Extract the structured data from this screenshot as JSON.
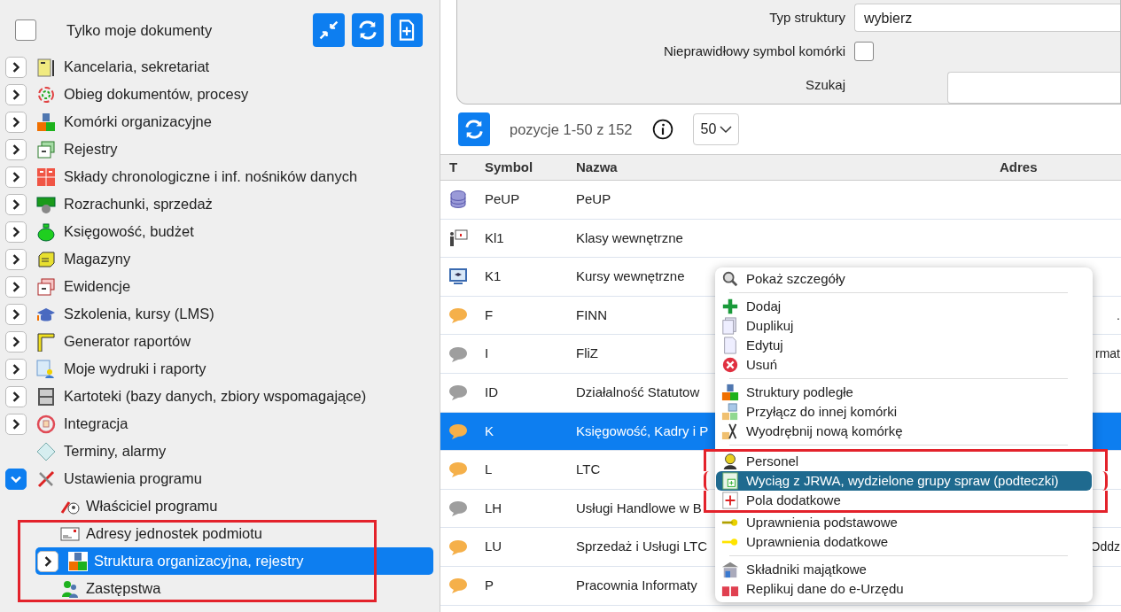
{
  "sidebar": {
    "only_mine": {
      "label": "Tylko moje dokumenty",
      "checked": false
    },
    "tree": [
      {
        "label": "Kancelaria, sekretariat",
        "expandable": true,
        "expanded": false,
        "selected": false
      },
      {
        "label": "Obieg dokumentów, procesy",
        "expandable": true,
        "expanded": false,
        "selected": false
      },
      {
        "label": "Komórki organizacyjne",
        "expandable": true,
        "expanded": false,
        "selected": false
      },
      {
        "label": "Rejestry",
        "expandable": true,
        "expanded": false,
        "selected": false
      },
      {
        "label": "Składy chronologiczne i inf. nośników danych",
        "expandable": true,
        "expanded": false,
        "selected": false
      },
      {
        "label": "Rozrachunki, sprzedaż",
        "expandable": true,
        "expanded": false,
        "selected": false
      },
      {
        "label": "Księgowość, budżet",
        "expandable": true,
        "expanded": false,
        "selected": false
      },
      {
        "label": "Magazyny",
        "expandable": true,
        "expanded": false,
        "selected": false
      },
      {
        "label": "Ewidencje",
        "expandable": true,
        "expanded": false,
        "selected": false
      },
      {
        "label": "Szkolenia, kursy (LMS)",
        "expandable": true,
        "expanded": false,
        "selected": false
      },
      {
        "label": "Generator raportów",
        "expandable": true,
        "expanded": false,
        "selected": false
      },
      {
        "label": "Moje wydruki i raporty",
        "expandable": true,
        "expanded": false,
        "selected": false
      },
      {
        "label": "Kartoteki (bazy danych, zbiory wspomagające)",
        "expandable": true,
        "expanded": false,
        "selected": false
      },
      {
        "label": "Integracja",
        "expandable": true,
        "expanded": false,
        "selected": false
      },
      {
        "label": "Terminy, alarmy",
        "expandable": false,
        "selected": false
      },
      {
        "label": "Ustawienia programu",
        "expandable": true,
        "expanded": true,
        "selected": false,
        "children": [
          {
            "label": "Właściciel programu",
            "expandable": false,
            "selected": false,
            "highlighted": false
          },
          {
            "label": "Adresy jednostek podmiotu",
            "expandable": false,
            "selected": false,
            "highlighted": true
          },
          {
            "label": "Struktura organizacyjna, rejestry",
            "expandable": true,
            "expanded": false,
            "selected": true,
            "highlighted": true
          },
          {
            "label": "Zastępstwa",
            "expandable": false,
            "selected": false,
            "highlighted": true
          }
        ]
      }
    ]
  },
  "filters": {
    "structure_type": {
      "label": "Typ struktury",
      "value": "wybierz"
    },
    "invalid_symbol": {
      "label": "Nieprawidłowy symbol komórki",
      "checked": false
    },
    "search": {
      "label": "Szukaj"
    }
  },
  "toolbar": {
    "range": "pozycje 1-50 z 152",
    "page_size": "50"
  },
  "table": {
    "columns": [
      "T",
      "Symbol",
      "Nazwa",
      "Adres"
    ],
    "rows": [
      {
        "kind": "database",
        "symbol": "PeUP",
        "name": "PeUP",
        "selected": false
      },
      {
        "kind": "presentation",
        "symbol": "Kl1",
        "name": "Klasy wewnętrzne",
        "selected": false
      },
      {
        "kind": "course",
        "symbol": "K1",
        "name": "Kursy wewnętrzne",
        "selected": false
      },
      {
        "kind": "bubble",
        "color": "#f5b04a",
        "symbol": "F",
        "name": "FINN",
        "address": ".",
        "selected": false
      },
      {
        "kind": "bubble",
        "color": "#9e9e9e",
        "symbol": "I",
        "name": "FliZ",
        "address": "rmat",
        "selected": false
      },
      {
        "kind": "bubble",
        "color": "#9e9e9e",
        "symbol": "ID",
        "name": "Działalność Statutow",
        "selected": false
      },
      {
        "kind": "bubble",
        "color": "#f5b04a",
        "symbol": "K",
        "name": "Księgowość, Kadry i P",
        "selected": true
      },
      {
        "kind": "bubble",
        "color": "#f5b04a",
        "symbol": "L",
        "name": "LTC",
        "selected": false
      },
      {
        "kind": "bubble",
        "color": "#9e9e9e",
        "symbol": "LH",
        "name": "Usługi Handlowe w B",
        "selected": false
      },
      {
        "kind": "bubble",
        "color": "#f5b04a",
        "symbol": "LU",
        "name": "Sprzedaż i Usługi LTC",
        "address": "Oddz",
        "selected": false
      },
      {
        "kind": "bubble",
        "color": "#f5b04a",
        "symbol": "P",
        "name": "Pracownia Informaty",
        "selected": false
      }
    ]
  },
  "context_menu": {
    "groups": [
      [
        {
          "label": "Pokaż szczegóły",
          "selected": false,
          "highlighted": false
        }
      ],
      [
        {
          "label": "Dodaj",
          "selected": false,
          "highlighted": false
        },
        {
          "label": "Duplikuj",
          "selected": false,
          "highlighted": false
        },
        {
          "label": "Edytuj",
          "selected": false,
          "highlighted": false
        },
        {
          "label": "Usuń",
          "selected": false,
          "highlighted": false
        }
      ],
      [
        {
          "label": "Struktury podległe",
          "selected": false,
          "highlighted": false
        },
        {
          "label": "Przyłącz do innej komórki",
          "selected": false,
          "highlighted": false
        },
        {
          "label": "Wyodrębnij nową komórkę",
          "selected": false,
          "highlighted": false
        }
      ],
      [
        {
          "label": "Personel",
          "selected": false,
          "highlighted": true
        },
        {
          "label": "Wyciąg z JRWA, wydzielone grupy spraw (podteczki)",
          "selected": true,
          "highlighted": true
        },
        {
          "label": "Pola dodatkowe",
          "selected": false,
          "highlighted": true
        },
        {
          "label": "Uprawnienia podstawowe",
          "selected": false,
          "highlighted": false
        },
        {
          "label": "Uprawnienia dodatkowe",
          "selected": false,
          "highlighted": false
        }
      ],
      [
        {
          "label": "Składniki majątkowe",
          "selected": false,
          "highlighted": false
        },
        {
          "label": "Replikuj dane do e-Urzędu",
          "selected": false,
          "highlighted": false
        }
      ]
    ]
  }
}
